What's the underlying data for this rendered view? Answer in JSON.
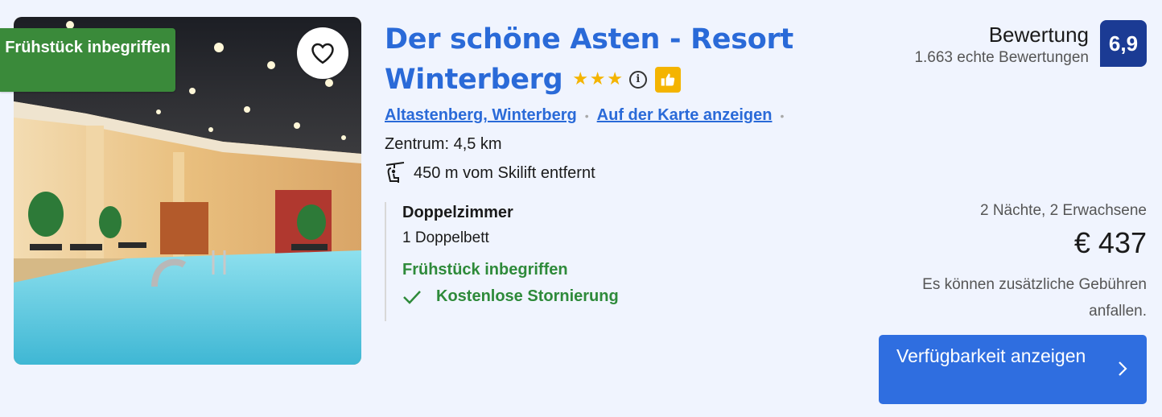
{
  "badge": {
    "label": "Frühstück inbegriffen"
  },
  "hotel": {
    "name_line1": "Der schöne Asten - Resort",
    "name_line2": "Winterberg",
    "stars": 3,
    "location_link": "Altastenberg, Winterberg",
    "map_link": "Auf der Karte anzeigen",
    "center_distance": "Zentrum: 4,5 km",
    "ski_distance": "450 m vom Skilift entfernt"
  },
  "room": {
    "name": "Doppelzimmer",
    "bed": "1 Doppelbett",
    "breakfast": "Frühstück inbegriffen",
    "cancellation": "Kostenlose Stornierung"
  },
  "rating": {
    "word": "Bewertung",
    "count": "1.663 echte Bewertungen",
    "score": "6,9"
  },
  "price": {
    "stay": "2 Nächte, 2 Erwachsene",
    "amount": "€ 437",
    "fees_note": "Es können zusätzliche Gebühren anfallen."
  },
  "cta": {
    "label": "Verfügbarkeit anzeigen"
  },
  "icons": [
    "heart-icon",
    "star-icon",
    "info-icon",
    "thumbs-up-icon",
    "ski-lift-icon",
    "check-icon",
    "chevron-right-icon"
  ],
  "colors": {
    "brand_blue": "#2a6ad8",
    "score_bg": "#1b3b94",
    "green": "#2e8a3a",
    "badge_green": "#3a8a3a",
    "cta_blue": "#2f6ee0",
    "star_yellow": "#f4b400"
  }
}
